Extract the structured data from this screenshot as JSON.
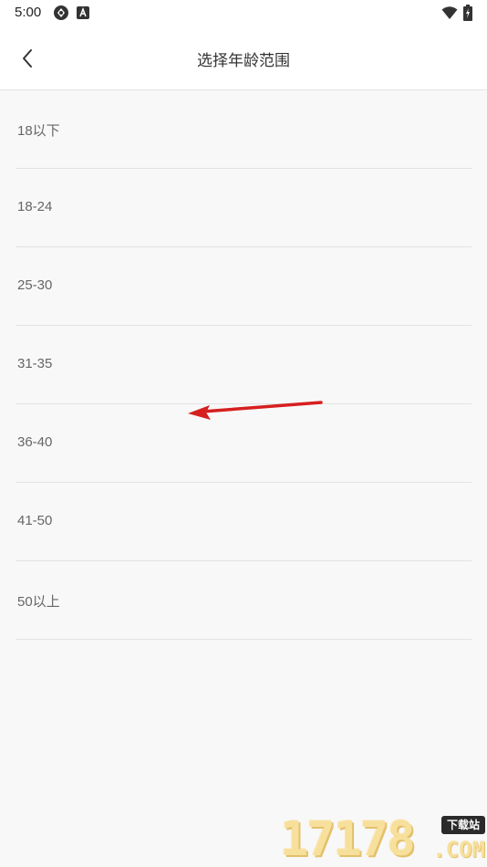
{
  "status_bar": {
    "time": "5:00"
  },
  "header": {
    "title": "选择年龄范围"
  },
  "age_ranges": [
    {
      "label": "18以下"
    },
    {
      "label": "18-24"
    },
    {
      "label": "25-30"
    },
    {
      "label": "31-35"
    },
    {
      "label": "36-40"
    },
    {
      "label": "41-50"
    },
    {
      "label": "50以上"
    }
  ],
  "watermark": {
    "digits": "17178",
    "badge": "下载站",
    "suffix": ".COM"
  },
  "colors": {
    "annotation_arrow": "#d61f1f",
    "watermark": "#f7df9c"
  }
}
